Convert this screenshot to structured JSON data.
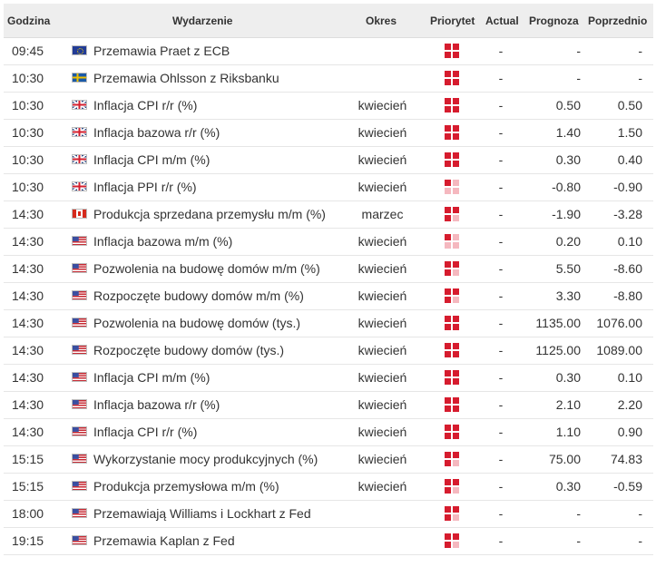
{
  "header": {
    "time": "Godzina",
    "event": "Wydarzenie",
    "period": "Okres",
    "priority": "Priorytet",
    "actual": "Actual",
    "forecast": "Prognoza",
    "previous": "Poprzednio"
  },
  "colors": {
    "priority_on": "#d61c2e",
    "priority_off": "#f5b8bf",
    "header_bg": "#eeeeee"
  },
  "rows": [
    {
      "time": "09:45",
      "flag": "eu-flag-icon",
      "event": "Przemawia Praet z ECB",
      "period": "",
      "priority": 3,
      "actual": "-",
      "forecast": "-",
      "previous": "-"
    },
    {
      "time": "10:30",
      "flag": "se-flag-icon",
      "event": "Przemawia Ohlsson z Riksbanku",
      "period": "",
      "priority": 3,
      "actual": "-",
      "forecast": "-",
      "previous": "-"
    },
    {
      "time": "10:30",
      "flag": "gb-flag-icon",
      "event": "Inflacja CPI r/r (%)",
      "period": "kwiecień",
      "priority": 4,
      "actual": "-",
      "forecast": "0.50",
      "previous": "0.50"
    },
    {
      "time": "10:30",
      "flag": "gb-flag-icon",
      "event": "Inflacja bazowa r/r (%)",
      "period": "kwiecień",
      "priority": 3,
      "actual": "-",
      "forecast": "1.40",
      "previous": "1.50"
    },
    {
      "time": "10:30",
      "flag": "gb-flag-icon",
      "event": "Inflacja CPI m/m (%)",
      "period": "kwiecień",
      "priority": 3,
      "actual": "-",
      "forecast": "0.30",
      "previous": "0.40"
    },
    {
      "time": "10:30",
      "flag": "gb-flag-icon",
      "event": "Inflacja PPI r/r (%)",
      "period": "kwiecień",
      "priority": 1,
      "actual": "-",
      "forecast": "-0.80",
      "previous": "-0.90"
    },
    {
      "time": "14:30",
      "flag": "ca-flag-icon",
      "event": "Produkcja sprzedana przemysłu m/m (%)",
      "period": "marzec",
      "priority": 2,
      "actual": "-",
      "forecast": "-1.90",
      "previous": "-3.28"
    },
    {
      "time": "14:30",
      "flag": "us-flag-icon",
      "event": "Inflacja bazowa m/m (%)",
      "period": "kwiecień",
      "priority": 1,
      "actual": "-",
      "forecast": "0.20",
      "previous": "0.10"
    },
    {
      "time": "14:30",
      "flag": "us-flag-icon",
      "event": "Pozwolenia na budowę domów m/m (%)",
      "period": "kwiecień",
      "priority": 2,
      "actual": "-",
      "forecast": "5.50",
      "previous": "-8.60"
    },
    {
      "time": "14:30",
      "flag": "us-flag-icon",
      "event": "Rozpoczęte budowy domów m/m (%)",
      "period": "kwiecień",
      "priority": 2,
      "actual": "-",
      "forecast": "3.30",
      "previous": "-8.80"
    },
    {
      "time": "14:30",
      "flag": "us-flag-icon",
      "event": "Pozwolenia na budowę domów (tys.)",
      "period": "kwiecień",
      "priority": 3,
      "actual": "-",
      "forecast": "1135.00",
      "previous": "1076.00"
    },
    {
      "time": "14:30",
      "flag": "us-flag-icon",
      "event": "Rozpoczęte budowy domów (tys.)",
      "period": "kwiecień",
      "priority": 3,
      "actual": "-",
      "forecast": "1125.00",
      "previous": "1089.00"
    },
    {
      "time": "14:30",
      "flag": "us-flag-icon",
      "event": "Inflacja CPI m/m (%)",
      "period": "kwiecień",
      "priority": 3,
      "actual": "-",
      "forecast": "0.30",
      "previous": "0.10"
    },
    {
      "time": "14:30",
      "flag": "us-flag-icon",
      "event": "Inflacja bazowa r/r (%)",
      "period": "kwiecień",
      "priority": 4,
      "actual": "-",
      "forecast": "2.10",
      "previous": "2.20"
    },
    {
      "time": "14:30",
      "flag": "us-flag-icon",
      "event": "Inflacja CPI r/r (%)",
      "period": "kwiecień",
      "priority": 4,
      "actual": "-",
      "forecast": "1.10",
      "previous": "0.90"
    },
    {
      "time": "15:15",
      "flag": "us-flag-icon",
      "event": "Wykorzystanie mocy produkcyjnych (%)",
      "period": "kwiecień",
      "priority": 2,
      "actual": "-",
      "forecast": "75.00",
      "previous": "74.83"
    },
    {
      "time": "15:15",
      "flag": "us-flag-icon",
      "event": "Produkcja przemysłowa m/m (%)",
      "period": "kwiecień",
      "priority": 2,
      "actual": "-",
      "forecast": "0.30",
      "previous": "-0.59"
    },
    {
      "time": "18:00",
      "flag": "us-flag-icon",
      "event": "Przemawiają Williams i Lockhart z Fed",
      "period": "",
      "priority": 2,
      "actual": "-",
      "forecast": "-",
      "previous": "-"
    },
    {
      "time": "19:15",
      "flag": "us-flag-icon",
      "event": "Przemawia Kaplan z Fed",
      "period": "",
      "priority": 2,
      "actual": "-",
      "forecast": "-",
      "previous": "-"
    }
  ]
}
